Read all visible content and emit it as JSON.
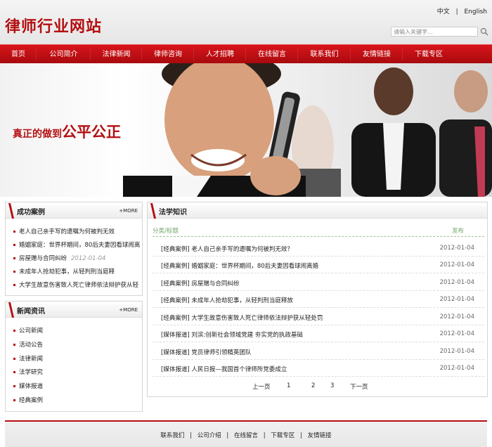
{
  "header": {
    "logo": "律师行业网站",
    "lang_zh": "中文",
    "lang_sep": "|",
    "lang_en": "English",
    "search_placeholder": "请输入关键字..."
  },
  "nav": {
    "items": [
      "首页",
      "公司简介",
      "法律新闻",
      "律师咨询",
      "人才招聘",
      "在线留言",
      "联系我们",
      "友情链接",
      "下载专区"
    ]
  },
  "banner": {
    "slogan_prefix": "真正的做到",
    "slogan_big": "公平公正"
  },
  "cases": {
    "title": "成功案例",
    "more": "+MORE",
    "items": [
      {
        "text": "老人自己亲手写的遗嘱为何被判无效"
      },
      {
        "text": "婚姻家庭：世界杯期间，80后夫妻因看球闹离"
      },
      {
        "text": "房屋赠与合同纠纷",
        "date": "2012-01-04"
      },
      {
        "text": "未成年人抢劫犯事，从轻判刑当庭释"
      },
      {
        "text": "大学生故意伤害致人死亡律师依法辩护获从轻"
      }
    ]
  },
  "news": {
    "title": "新闻资讯",
    "more": "+MORE",
    "items": [
      "公司新闻",
      "活动公告",
      "法律新闻",
      "法学研究",
      "媒体报道",
      "经典案例"
    ]
  },
  "knowledge": {
    "title": "法学知识",
    "col_category": "分类/标题",
    "col_date": "发布",
    "rows": [
      {
        "title": "[经典案例] 老人自己亲手写的遗嘱为何被判无效？",
        "date": "2012-01-04"
      },
      {
        "title": "[经典案例] 婚姻家庭：世界杯期间，80后夫妻因看球闹离婚",
        "date": "2012-01-04"
      },
      {
        "title": "[经典案例] 房屋赠与合同纠纷",
        "date": "2012-01-04"
      },
      {
        "title": "[经典案例] 未成年人抢劫犯事，从轻判刑当庭释放",
        "date": "2012-01-04"
      },
      {
        "title": "[经典案例] 大学生故意伤害致人死亡律师依法辩护获从轻处罚",
        "date": "2012-01-04"
      },
      {
        "title": "[媒体报道] 刘滨:创新社会领域党建 夯实党的执政基础",
        "date": "2012-01-04"
      },
      {
        "title": "[媒体报道] 党员律师引领精英团队",
        "date": "2012-01-04"
      },
      {
        "title": "[媒体报道] 人民日报—我国首个律师所党委成立",
        "date": "2012-01-04"
      }
    ],
    "pager": {
      "prev": "上一页",
      "p1": "1",
      "p2": "2",
      "p3": "3",
      "next": "下一页"
    }
  },
  "footer": {
    "links": [
      "联系我们",
      "公司介绍",
      "在线留言",
      "下载专区",
      "友情链接"
    ],
    "sep": "|"
  },
  "colors": {
    "brand_red": "#b40f12",
    "nav_red": "#c8121a",
    "green_header": "#76a76c"
  }
}
